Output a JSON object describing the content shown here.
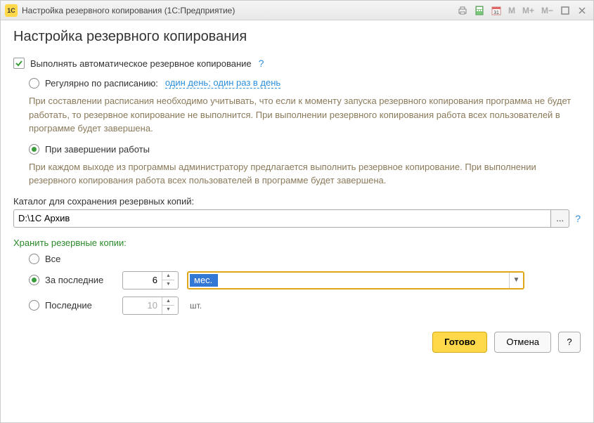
{
  "window": {
    "title": "Настройка резервного копирования  (1С:Предприятие)"
  },
  "page": {
    "title": "Настройка резервного копирования"
  },
  "auto_backup": {
    "label": "Выполнять автоматическое резервное копирование",
    "checked": true
  },
  "schedule_mode": {
    "by_schedule": {
      "label": "Регулярно по расписанию:",
      "link": "один день; один раз в день",
      "hint": "При составлении расписания необходимо учитывать, что если к моменту запуска резервного копирования программа не будет работать, то резервное копирование не выполнится. При выполнении резервного копирования работа всех пользователей в программе будет завершена."
    },
    "on_exit": {
      "label": "При завершении работы",
      "hint": "При каждом выходе из программы администратору предлагается выполнить резервное копирование. При выполнении резервного копирования работа всех пользователей в программе будет завершена."
    }
  },
  "catalog": {
    "label": "Каталог для сохранения резервных копий:",
    "value": "D:\\1С Архив",
    "browse": "..."
  },
  "retention": {
    "title": "Хранить резервные копии:",
    "all": {
      "label": "Все"
    },
    "last_period": {
      "label": "За последние",
      "count": "6",
      "unit": "мес."
    },
    "last_count": {
      "label": "Последние",
      "count": "10",
      "unit": "шт."
    }
  },
  "buttons": {
    "ok": "Готово",
    "cancel": "Отмена",
    "help": "?"
  }
}
